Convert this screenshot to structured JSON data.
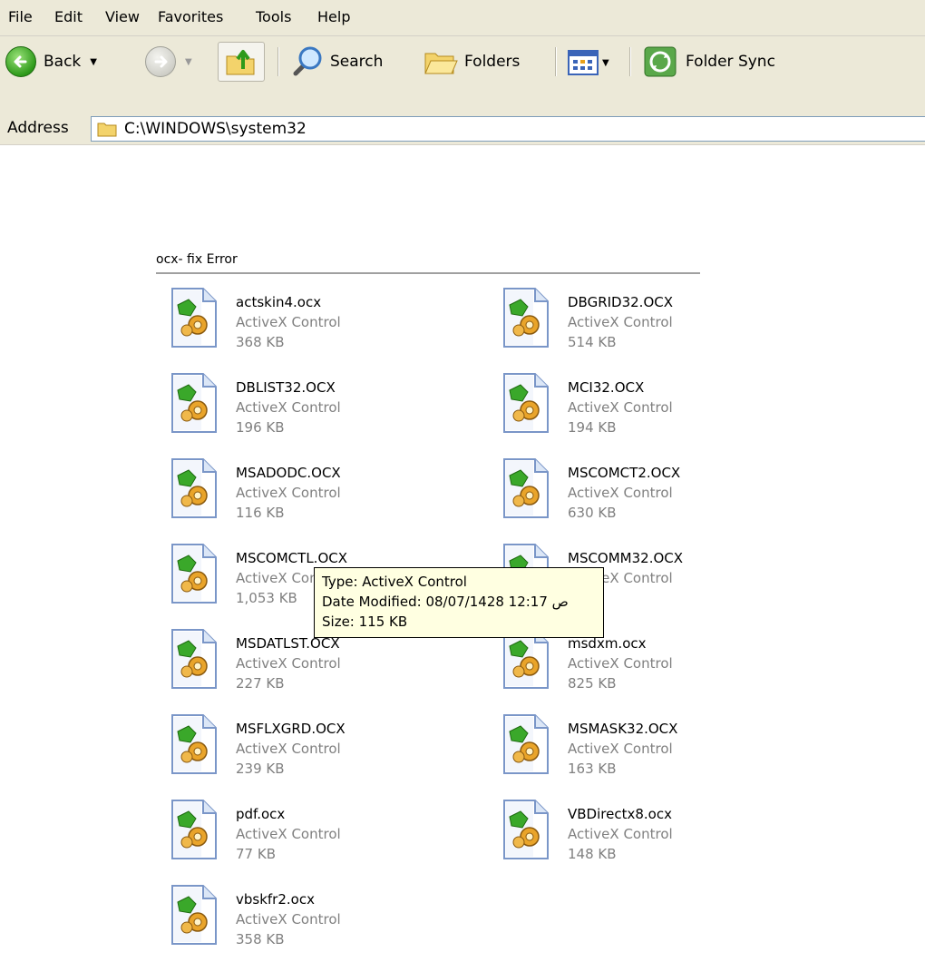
{
  "menubar": {
    "items": [
      "File",
      "Edit",
      "View",
      "Favorites",
      "Tools",
      "Help"
    ]
  },
  "toolbar": {
    "back_label": "Back",
    "search_label": "Search",
    "folders_label": "Folders",
    "folder_sync_label": "Folder Sync"
  },
  "address": {
    "label": "Address",
    "path": "C:\\WINDOWS\\system32"
  },
  "group": {
    "title": "ocx- fix Error"
  },
  "files": [
    {
      "name": "actskin4.ocx",
      "type": "ActiveX Control",
      "size": "368 KB"
    },
    {
      "name": "DBGRID32.OCX",
      "type": "ActiveX Control",
      "size": "514 KB"
    },
    {
      "name": "DBLIST32.OCX",
      "type": "ActiveX Control",
      "size": "196 KB"
    },
    {
      "name": "MCI32.OCX",
      "type": "ActiveX Control",
      "size": "194 KB"
    },
    {
      "name": "MSADODC.OCX",
      "type": "ActiveX Control",
      "size": "116 KB"
    },
    {
      "name": "MSCOMCT2.OCX",
      "type": "ActiveX Control",
      "size": "630 KB"
    },
    {
      "name": "MSCOMCTL.OCX",
      "type": "ActiveX Control",
      "size": "1,053 KB"
    },
    {
      "name": "MSCOMM32.OCX",
      "type": "ActiveX Control",
      "size": "KB"
    },
    {
      "name": "MSDATLST.OCX",
      "type": "ActiveX Control",
      "size": "227 KB"
    },
    {
      "name": "msdxm.ocx",
      "type": "ActiveX Control",
      "size": "825 KB"
    },
    {
      "name": "MSFLXGRD.OCX",
      "type": "ActiveX Control",
      "size": "239 KB"
    },
    {
      "name": "MSMASK32.OCX",
      "type": "ActiveX Control",
      "size": "163 KB"
    },
    {
      "name": "pdf.ocx",
      "type": "ActiveX Control",
      "size": "77 KB"
    },
    {
      "name": "VBDirectx8.ocx",
      "type": "ActiveX Control",
      "size": "148 KB"
    },
    {
      "name": "vbskfr2.ocx",
      "type": "ActiveX Control",
      "size": "358 KB"
    }
  ],
  "tooltip": {
    "type_line": "Type: ActiveX Control",
    "date_line": "Date Modified: 08/07/1428 12:17 ص",
    "size_line": "Size: 115 KB"
  }
}
